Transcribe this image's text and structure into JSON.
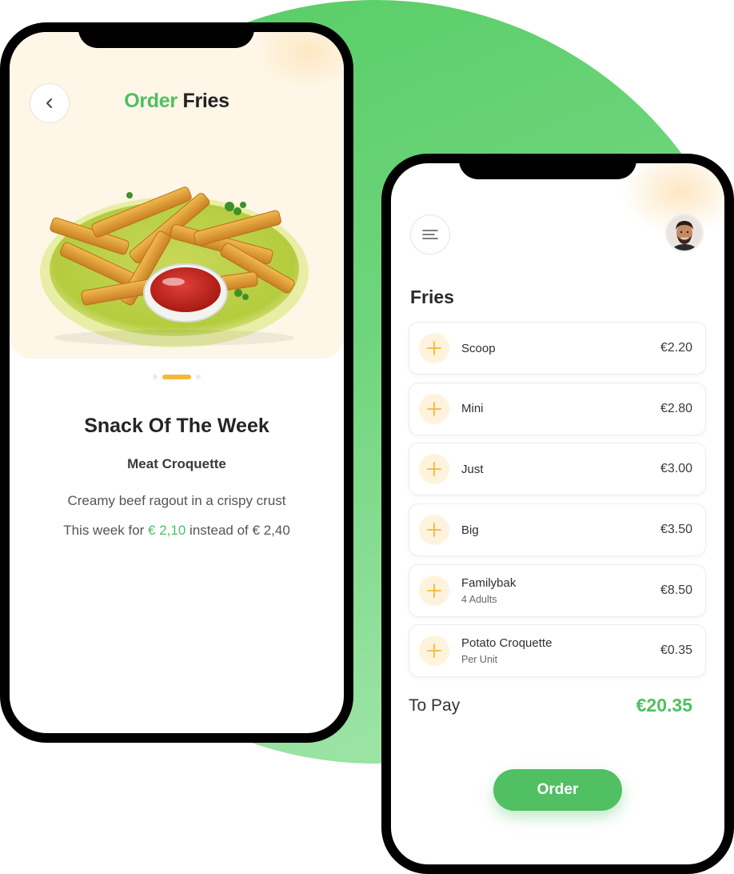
{
  "colors": {
    "brand_green": "#4cc160",
    "accent_yellow": "#f4b93a",
    "hero_background": "#fef6e6"
  },
  "left_screen": {
    "back_icon": "chevron-left-icon",
    "title_part1": "Order",
    "title_part2": "Fries",
    "carousel": {
      "pages": 3,
      "active_index": 1
    },
    "snack": {
      "heading": "Snack Of The Week",
      "name": "Meat Croquette",
      "description": "Creamy beef ragout in a crispy crust",
      "price_prefix": "This week for",
      "price_now": "€ 2,10",
      "price_mid": "instead of",
      "price_was": "€ 2,40"
    }
  },
  "right_screen": {
    "menu_icon": "hamburger-menu-icon",
    "avatar_icon": "user-avatar",
    "section_title": "Fries",
    "items": [
      {
        "name": "Scoop",
        "sub": "",
        "price": "€2.20"
      },
      {
        "name": "Mini",
        "sub": "",
        "price": "€2.80"
      },
      {
        "name": "Just",
        "sub": "",
        "price": "€3.00"
      },
      {
        "name": "Big",
        "sub": "",
        "price": "€3.50"
      },
      {
        "name": "Familybak",
        "sub": "4 Adults",
        "price": "€8.50"
      },
      {
        "name": "Potato Croquette",
        "sub": "Per Unit",
        "price": "€0.35"
      }
    ],
    "to_pay_label": "To Pay",
    "to_pay_value": "€20.35",
    "order_button": "Order"
  }
}
